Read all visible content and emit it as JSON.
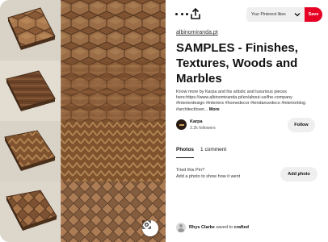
{
  "actions": {
    "more_icon": "ellipsis-icon",
    "share_icon": "share-upload-icon",
    "board_select_value": "Your Pinterest likes",
    "save_label": "Save"
  },
  "pin": {
    "source": "albinomiranda.pt",
    "title": "SAMPLES - Finishes, Textures, Woods and Marbles",
    "description": "Know more by Karpa and his artistic and luxurious pieces here:https://www.albinomiranda.pt/en/about-us/the-company #interiordesign #interiors #homedecor #tendancedeco #interiorblog #architectlover...",
    "more_label": "More"
  },
  "creator": {
    "name": "Karpa",
    "followers": "3.2k followers",
    "follow_label": "Follow"
  },
  "tabs": [
    {
      "label": "Photos",
      "active": true
    },
    {
      "label": "1 comment",
      "active": false
    }
  ],
  "tried": {
    "title": "Tried this Pin?",
    "subtitle": "Add a photo to show how it went",
    "add_photo_label": "Add photo"
  },
  "saved_by": {
    "user": "Rhys Clarke",
    "middle": "saved to",
    "board": "crafted"
  },
  "image": {
    "lens_icon": "visual-search-icon",
    "colors": {
      "wood_dark": "#6b4a2e",
      "wood_mid": "#9a6b45",
      "wood_light": "#b98c62",
      "background": "#d9d2c6"
    }
  },
  "colors": {
    "save_red": "#e60023",
    "button_gray": "#efefef"
  }
}
